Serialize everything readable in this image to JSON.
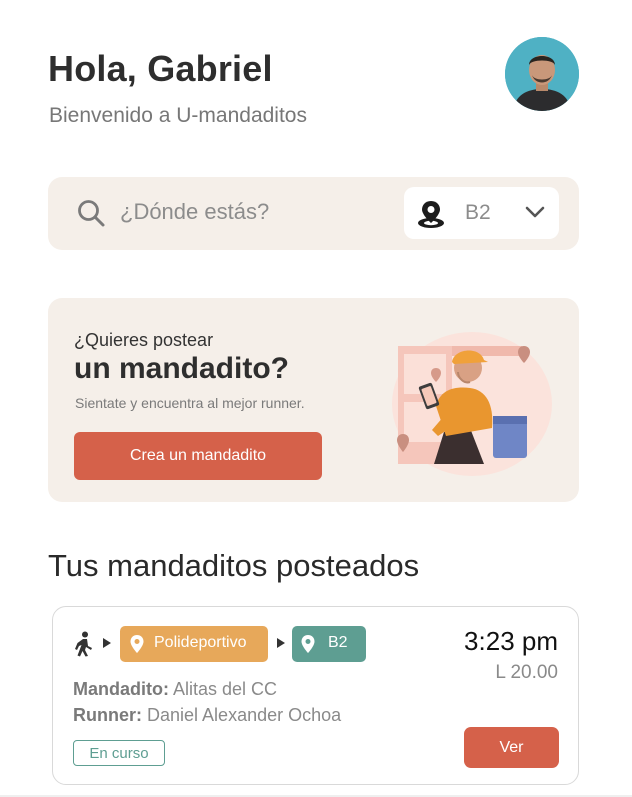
{
  "header": {
    "greeting": "Hola, Gabriel",
    "subtitle": "Bienvenido a U-mandaditos",
    "avatar_icon": "user-avatar"
  },
  "search": {
    "placeholder": "¿Dónde estás?",
    "location_value": "B2",
    "search_icon": "search-icon",
    "location_icon": "map-pin-icon",
    "dropdown_icon": "chevron-down-icon"
  },
  "promo": {
    "question": "¿Quieres postear",
    "title": "un mandadito?",
    "description": "Sientate y encuentra al mejor runner.",
    "button_label": "Crea un mandadito",
    "illustration": "delivery-person-illustration"
  },
  "section": {
    "title": "Tus mandaditos posteados"
  },
  "orders": [
    {
      "origin": "Polideportivo",
      "destination": "B2",
      "time": "3:23 pm",
      "price": "L 20.00",
      "errand_label": "Mandadito:",
      "errand_value": "Alitas del CC",
      "runner_label": "Runner:",
      "runner_value": "Daniel Alexander Ochoa",
      "status": "En curso",
      "view_label": "Ver"
    }
  ],
  "colors": {
    "accent": "#d5614a",
    "card_bg": "#f5efe9",
    "origin_badge": "#e7a85a",
    "destination_badge": "#5e9e92",
    "status_border": "#5e9e92"
  }
}
